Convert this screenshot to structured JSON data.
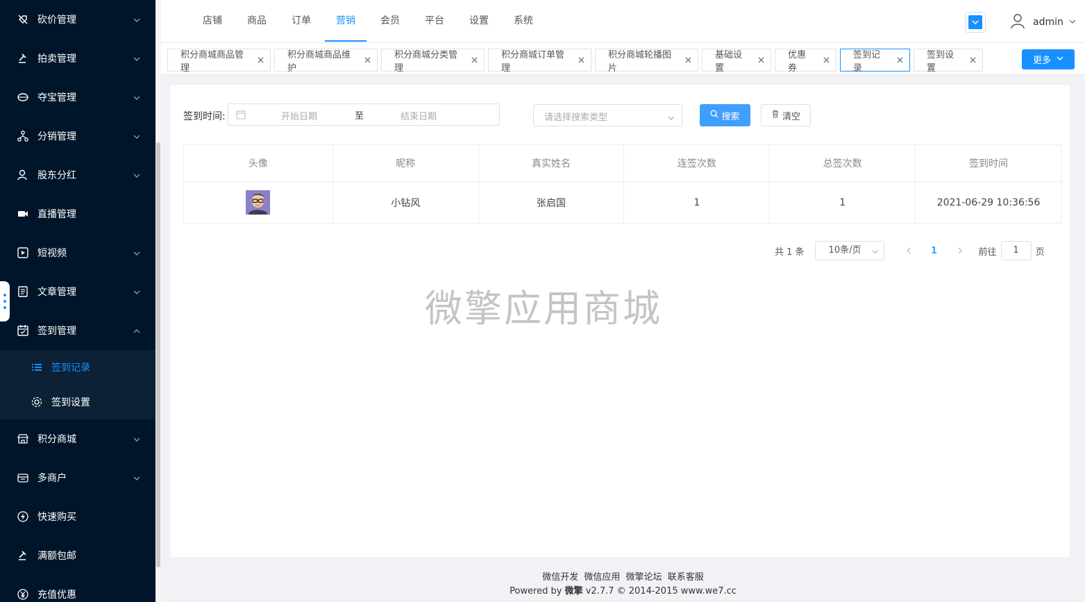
{
  "sidebar": {
    "items": [
      {
        "label": "砍价管理",
        "icon": "bargain-icon",
        "arrow": "down"
      },
      {
        "label": "拍卖管理",
        "icon": "gavel-icon",
        "arrow": "down"
      },
      {
        "label": "夺宝管理",
        "icon": "treasure-icon",
        "arrow": "down"
      },
      {
        "label": "分销管理",
        "icon": "network-icon",
        "arrow": "down"
      },
      {
        "label": "股东分红",
        "icon": "shareholder-icon",
        "arrow": "down"
      },
      {
        "label": "直播管理",
        "icon": "video-camera-icon",
        "arrow": "none"
      },
      {
        "label": "短视频",
        "icon": "play-icon",
        "arrow": "down"
      },
      {
        "label": "文章管理",
        "icon": "document-icon",
        "arrow": "down"
      },
      {
        "label": "签到管理",
        "icon": "calendar-check-icon",
        "arrow": "up"
      }
    ],
    "submenu": [
      {
        "label": "签到记录",
        "icon": "list-icon",
        "active": true
      },
      {
        "label": "签到设置",
        "icon": "gear-icon",
        "active": false
      }
    ],
    "items_after": [
      {
        "label": "积分商城",
        "icon": "store-icon",
        "arrow": "down"
      },
      {
        "label": "多商户",
        "icon": "merchant-icon",
        "arrow": "down"
      },
      {
        "label": "快速购买",
        "icon": "lightning-icon",
        "arrow": "none"
      },
      {
        "label": "满额包邮",
        "icon": "gavel-icon",
        "arrow": "none"
      },
      {
        "label": "充值优惠",
        "icon": "yen-icon",
        "arrow": "none"
      }
    ]
  },
  "topnav": {
    "items": [
      "店铺",
      "商品",
      "订单",
      "营销",
      "会员",
      "平台",
      "设置",
      "系统"
    ],
    "active_index": 3,
    "user": "admin"
  },
  "tabs": {
    "items": [
      "积分商城商品管理",
      "积分商城商品维护",
      "积分商城分类管理",
      "积分商城订单管理",
      "积分商城轮播图片",
      "基础设置",
      "优惠券",
      "签到记录",
      "签到设置"
    ],
    "active_index": 7,
    "more_label": "更多"
  },
  "filter": {
    "label": "签到时间:",
    "start_placeholder": "开始日期",
    "separator": "至",
    "end_placeholder": "结束日期",
    "type_placeholder": "请选择搜索类型",
    "search_label": "搜索",
    "clear_label": "清空"
  },
  "table": {
    "columns": [
      "头像",
      "昵称",
      "真实姓名",
      "连签次数",
      "总签次数",
      "签到时间"
    ],
    "rows": [
      {
        "nickname": "小钻风",
        "real_name": "张启国",
        "streak": "1",
        "total": "1",
        "time": "2021-06-29 10:36:56"
      }
    ]
  },
  "pager": {
    "total": "共 1 条",
    "page_size": "10条/页",
    "current_page": "1",
    "goto_label": "前往",
    "goto_value": "1",
    "page_suffix": "页"
  },
  "watermark": "微擎应用商城",
  "footer": {
    "links": [
      "微信开发",
      "微信应用",
      "微擎论坛",
      "联系客服"
    ],
    "powered_prefix": "Powered by",
    "brand": "微擎",
    "version": "v2.7.7 © 2014-2015",
    "site": "www.we7.cc"
  },
  "colors": {
    "sidebar_bg": "#001529",
    "submenu_bg": "#0c2135",
    "accent": "#1890ff",
    "button_primary": "#409eff"
  }
}
